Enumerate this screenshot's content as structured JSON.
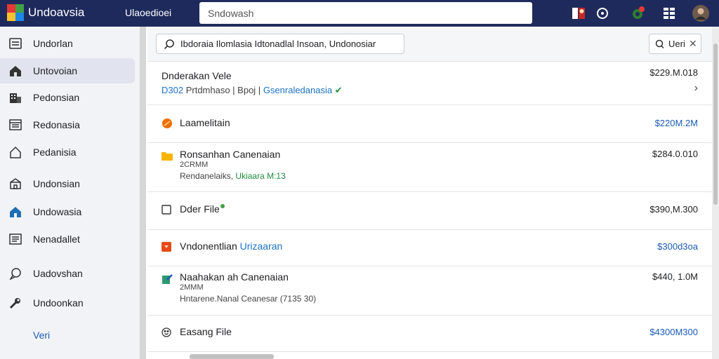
{
  "header": {
    "app_title": "Undoavsia",
    "top_link": "Ulaoedioei",
    "search_placeholder": "Sndowash",
    "icons": [
      "person-badge-icon",
      "chat-icon",
      "notification-icon",
      "apps-grid-icon",
      "avatar"
    ]
  },
  "sidebar": {
    "items": [
      {
        "label": "Undorlan",
        "icon": "list-icon"
      },
      {
        "label": "Untovoian",
        "icon": "home-icon",
        "active": true
      },
      {
        "label": "Pedonsian",
        "icon": "building-icon"
      },
      {
        "label": "Redonasia",
        "icon": "table-icon"
      },
      {
        "label": "Pedanisia",
        "icon": "house-outline-icon"
      },
      {
        "label": "Undonsian",
        "icon": "store-icon"
      },
      {
        "label": "Undowasia",
        "icon": "cloud-home-icon"
      },
      {
        "label": "Nenadallet",
        "icon": "document-icon"
      },
      {
        "label": "Uadovshan",
        "icon": "chat-bubble-icon"
      },
      {
        "label": "Undoonkan",
        "icon": "tools-icon"
      }
    ],
    "footer": "Veri"
  },
  "filter": {
    "breadcrumb": "Ibdoraia Ilomlasia Idtonadlal Insoan, Undonosiar",
    "chip_label": "Ueri"
  },
  "rows": [
    {
      "name": "Dnderakan Vele",
      "amount": "$229.M.018",
      "meta": "D302",
      "detail": "Prtdmhaso | Bpoj |",
      "detail_link": "Gsenraledanasia"
    },
    {
      "name": "Laamelitain",
      "amount": "$220M.2M"
    },
    {
      "name": "Ronsanhan Canenaian",
      "amount": "$284.0.010",
      "line2": "2CRMM",
      "line3": "Rendanelaiks,",
      "line3_tag": "Ukiaara M:13"
    },
    {
      "name": "Dder File",
      "amount": "$390,M.300"
    },
    {
      "name": "Vndonentlian",
      "name_link": "Urizaaran",
      "amount": "$300d3oa"
    },
    {
      "name": "Naahakan ah Canenaian",
      "amount": "$440, 1.0M",
      "line2": "2MMM",
      "line3": "Hntarene.Nanal Ceanesar (7135 30)"
    },
    {
      "name": "Easang File",
      "amount": "$4300M300"
    }
  ],
  "colors": {
    "topbar": "#1f2a5c",
    "accent_blue": "#1a5bb5",
    "sidebar_bg": "#f2f3f7"
  }
}
